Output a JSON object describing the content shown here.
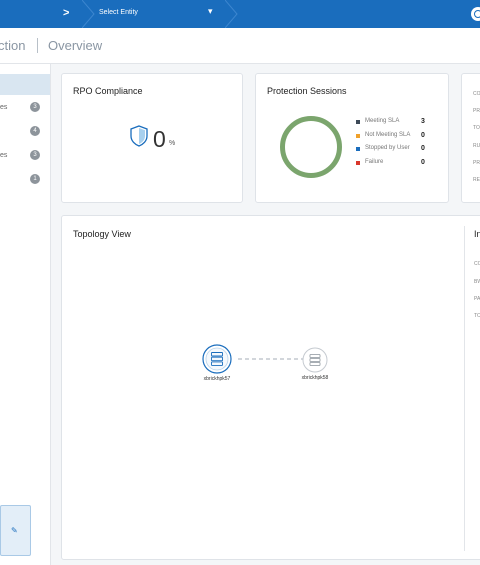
{
  "topbar": {
    "crumb_arrow": ">",
    "entity_select": "Select Entity",
    "entity_caret": "▾",
    "colors": {
      "bar": "#1a6dbd"
    }
  },
  "titlebar": {
    "section_fragment": "ction",
    "page": "Overview"
  },
  "sidebar": {
    "items": [
      {
        "label": "es",
        "count": "3"
      },
      {
        "label": "",
        "count": "4"
      },
      {
        "label": "es",
        "count": "3"
      },
      {
        "label": "",
        "count": "1"
      }
    ],
    "bottom_card_icon": "edit-icon"
  },
  "rpo": {
    "title": "RPO Compliance",
    "value": "0",
    "unit": "%",
    "icon": "shield-icon"
  },
  "sessions": {
    "title": "Protection Sessions",
    "legend": [
      {
        "label": "Meeting SLA",
        "value": "3",
        "color": "#3d4a57"
      },
      {
        "label": "Not Meeting SLA",
        "value": "0",
        "color": "#f0a12b"
      },
      {
        "label": "Stopped by User",
        "value": "0",
        "color": "#1a6dbd"
      },
      {
        "label": "Failure",
        "value": "0",
        "color": "#d9372b"
      }
    ],
    "ring_color": "#7ba56d",
    "chart_data": {
      "type": "pie",
      "categories": [
        "Meeting SLA",
        "Not Meeting SLA",
        "Stopped by User",
        "Failure"
      ],
      "values": [
        3,
        0,
        0,
        0
      ]
    }
  },
  "details": {
    "rows": [
      "CO",
      "PR",
      "TO",
      "RU",
      "PR",
      "RE"
    ]
  },
  "topology": {
    "title": "Topology View",
    "nodes": [
      {
        "name": "xbrickhpk57",
        "icon": "server-icon"
      },
      {
        "name": "xbrickhpk58",
        "icon": "server-icon"
      }
    ]
  },
  "info": {
    "title_fragment": "In",
    "rows": [
      "CO",
      "BW",
      "PA",
      "TO"
    ]
  }
}
